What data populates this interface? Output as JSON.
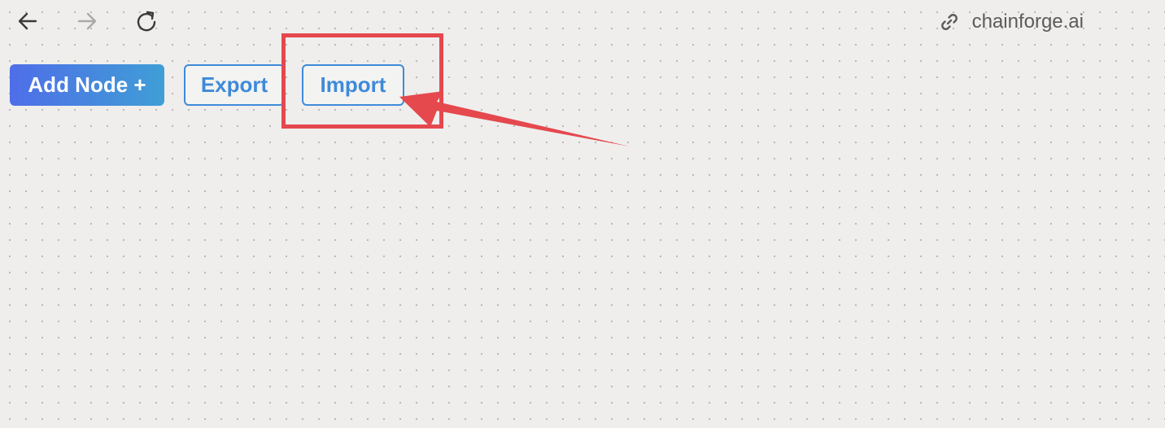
{
  "browser": {
    "url": "chainforge.ai",
    "icons": {
      "back": "arrow-left-icon",
      "forward": "arrow-right-icon",
      "reload": "reload-icon",
      "link": "link-icon"
    }
  },
  "toolbar": {
    "add_node_label": "Add Node +",
    "export_label": "Export",
    "import_label": "Import"
  },
  "colors": {
    "accent": "#3e8ad9",
    "gradient_start": "#4f6ee8",
    "gradient_end": "#3f9ed6",
    "annotation": "#e5484d",
    "canvas": "#efeeed"
  }
}
